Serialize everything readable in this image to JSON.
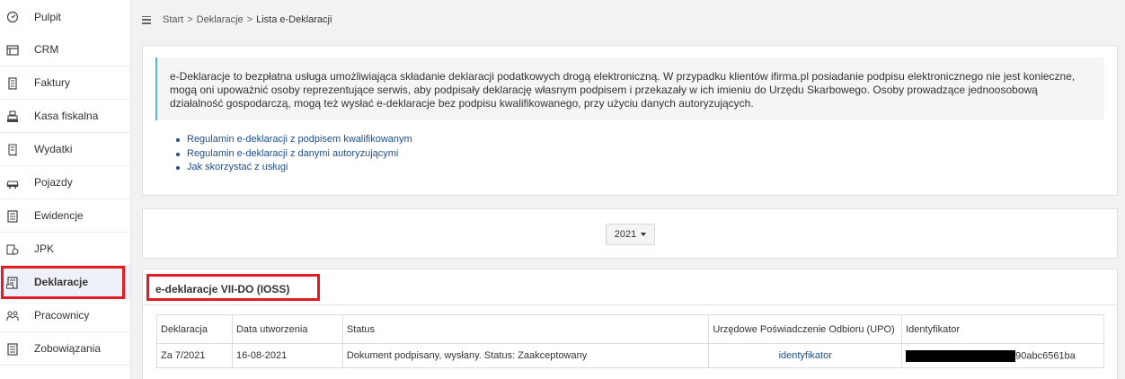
{
  "sidebar": {
    "items": [
      {
        "label": "Pulpit",
        "icon": "dashboard-icon"
      },
      {
        "label": "CRM",
        "icon": "crm-icon"
      },
      {
        "label": "Faktury",
        "icon": "invoice-icon"
      },
      {
        "label": "Kasa fiskalna",
        "icon": "cash-register-icon"
      },
      {
        "label": "Wydatki",
        "icon": "expenses-icon"
      },
      {
        "label": "Pojazdy",
        "icon": "car-icon"
      },
      {
        "label": "Ewidencje",
        "icon": "records-icon"
      },
      {
        "label": "JPK",
        "icon": "jpk-icon"
      },
      {
        "label": "Deklaracje",
        "icon": "declarations-icon",
        "active": true
      },
      {
        "label": "Pracownicy",
        "icon": "employees-icon"
      },
      {
        "label": "Zobowiązania",
        "icon": "liabilities-icon"
      }
    ]
  },
  "breadcrumb": {
    "items": [
      "Start",
      "Deklaracje",
      "Lista e-Deklaracji"
    ],
    "separator": ">"
  },
  "info": {
    "text": "e-Deklaracje to bezpłatna usługa umożliwiająca składanie deklaracji podatkowych drogą elektroniczną. W przypadku klientów ifirma.pl posiadanie podpisu elektronicznego nie jest konieczne, mogą oni upoważnić osoby reprezentujące serwis, aby podpisały deklarację własnym podpisem i przekazały w ich imieniu do Urzędu Skarbowego. Osoby prowadzące jednoosobową działalność gospodarczą, mogą też wysłać e-deklaracje bez podpisu kwalifikowanego, przy użyciu danych autoryzujących.",
    "links": [
      "Regulamin e-deklaracji z podpisem kwalifikowanym",
      "Regulamin e-deklaracji z danymi autoryzującymi",
      "Jak skorzystać z usługi"
    ]
  },
  "year_select": {
    "value": "2021"
  },
  "declarations": {
    "title": "e-deklaracje VII-DO (IOSS)",
    "columns": [
      "Deklaracja",
      "Data utworzenia",
      "Status",
      "Urzędowe Poświadczenie Odbioru (UPO)",
      "Identyfikator"
    ],
    "rows": [
      {
        "deklaracja": "Za 7/2021",
        "data": "16-08-2021",
        "status": "Dokument podpisany, wysłany. Status: Zaakceptowany",
        "upo": "identyfikator",
        "identyfikator_suffix": "90abc6561ba"
      }
    ]
  },
  "colors": {
    "highlight": "#e31b23",
    "link": "#1f4f8a",
    "callout_border": "#5db5c9"
  }
}
